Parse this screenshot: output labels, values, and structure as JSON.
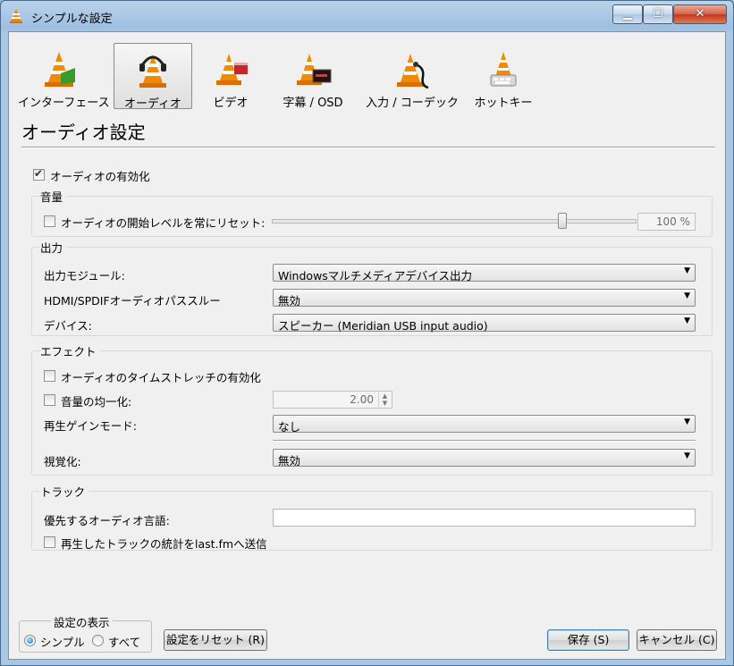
{
  "window": {
    "title": "シンプルな設定"
  },
  "categories": [
    {
      "label": "インターフェース",
      "icon": "vlc-cone-interface-icon",
      "selected": false
    },
    {
      "label": "オーディオ",
      "icon": "vlc-cone-headphones-icon",
      "selected": true
    },
    {
      "label": "ビデオ",
      "icon": "vlc-cone-video-icon",
      "selected": false
    },
    {
      "label": "字幕 / OSD",
      "icon": "vlc-cone-subtitles-icon",
      "selected": false
    },
    {
      "label": "入力 / コーデック",
      "icon": "vlc-cone-codec-icon",
      "selected": false
    },
    {
      "label": "ホットキー",
      "icon": "vlc-cone-hotkeys-icon",
      "selected": false
    }
  ],
  "page": {
    "title": "オーディオ設定"
  },
  "audio": {
    "enable_label": "オーディオの有効化",
    "enabled": true
  },
  "volume": {
    "title": "音量",
    "reset_label": "オーディオの開始レベルを常にリセット:",
    "reset_checked": false,
    "level": "100 %",
    "level_value": 100
  },
  "output": {
    "title": "出力",
    "module_label": "出力モジュール:",
    "module_value": "Windowsマルチメディアデバイス出力",
    "passthrough_label": "HDMI/SPDIFオーディオパススルー",
    "passthrough_value": "無効",
    "device_label": "デバイス:",
    "device_value": "スピーカー (Meridian USB input audio)"
  },
  "effects": {
    "title": "エフェクト",
    "timestretch_label": "オーディオのタイムストレッチの有効化",
    "timestretch_checked": false,
    "normalize_label": "音量の均一化:",
    "normalize_checked": false,
    "normalize_value": "2.00",
    "replaygain_label": "再生ゲインモード:",
    "replaygain_value": "なし",
    "visual_label": "視覚化:",
    "visual_value": "無効"
  },
  "tracks": {
    "title": "トラック",
    "lang_label": "優先するオーディオ言語:",
    "lang_value": "",
    "lastfm_label": "再生したトラックの統計をlast.fmへ送信",
    "lastfm_checked": false
  },
  "footer": {
    "show_title": "設定の表示",
    "simple_label": "シンプル",
    "all_label": "すべて",
    "reset_label": "設定をリセット (R)",
    "save_label": "保存 (S)",
    "cancel_label": "キャンセル (C)"
  }
}
